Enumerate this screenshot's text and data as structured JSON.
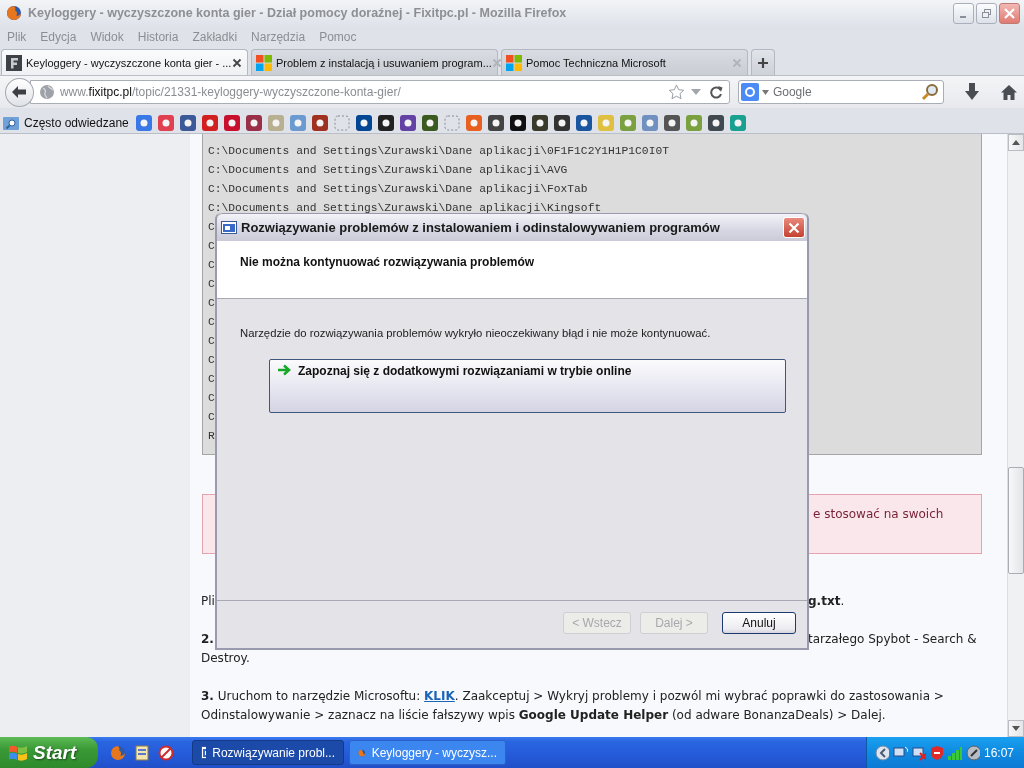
{
  "browser": {
    "title": "Keyloggery - wyczyszczone konta gier - Dział pomocy doraźnej - Fixitpc.pl - Mozilla Firefox",
    "menu": [
      "Plik",
      "Edycja",
      "Widok",
      "Historia",
      "Zakładki",
      "Narzędzia",
      "Pomoc"
    ],
    "tabs": [
      {
        "label": "Keyloggery - wyczyszczone konta gier - ...",
        "selected": true
      },
      {
        "label": "Problem z instalacją i usuwaniem program...",
        "selected": false
      },
      {
        "label": "Pomoc Techniczna Microsoft",
        "selected": false
      }
    ],
    "url": {
      "prefix": "www.",
      "domain": "fixitpc.pl",
      "path": "/topic/21331-keyloggery-wyczyszczone-konta-gier/"
    },
    "search": {
      "placeholder": "Google"
    },
    "bookmarks_folder": "Często odwiedzane"
  },
  "page": {
    "code_lines": [
      "C:\\Documents and Settings\\Zurawski\\Dane aplikacji\\0F1F1C2Y1H1P1C0I0T",
      "C:\\Documents and Settings\\Zurawski\\Dane aplikacji\\AVG",
      "C:\\Documents and Settings\\Zurawski\\Dane aplikacji\\FoxTab",
      "C:\\Documents and Settings\\Zurawski\\Dane aplikacji\\Kingsoft",
      "C",
      "C",
      "C",
      "C",
      "C",
      "C",
      "C",
      "C",
      "C",
      "C",
      "C",
      "R"
    ],
    "notice": "e stosować na swoich",
    "para_1": {
      "start": "Pli",
      "end": "**g.txt**."
    },
    "step_2": {
      "number": "2.",
      "end": "tarzałego Spybot - Search &",
      "next_line": "Destroy."
    },
    "step_3": {
      "before": "**3.** Uruchom to narzędzie Microsoftu: ",
      "link": "KLIK",
      "after": ". Zaakceptuj > Wykryj problemy i pozwól mi wybrać poprawki do zastosowania > Odinstalowywanie > zaznacz na liście fałszywy wpis **Google Update Helper** (od adware BonanzaDeals) > Dalej."
    }
  },
  "dialog": {
    "title": "Rozwiązywanie problemów z instalowaniem i odinstalowywaniem programów",
    "heading": "Nie można kontynuować rozwiązywania problemów",
    "message": "Narzędzie do rozwiązywania problemów wykryło nieoczekiwany błąd i nie może kontynuować.",
    "option": "Zapoznaj się z dodatkowymi rozwiązaniami w trybie online",
    "buttons": [
      {
        "label": "< Wstecz",
        "disabled": true
      },
      {
        "label": "Dalej >",
        "disabled": true
      },
      {
        "label": "Anuluj",
        "disabled": false
      }
    ]
  },
  "taskbar": {
    "start": "Start",
    "tasks": [
      {
        "label": "Rozwiązywanie probl...",
        "selected": true
      },
      {
        "label": "Keyloggery - wyczysz...",
        "selected": false
      }
    ],
    "clock": "16:07"
  }
}
